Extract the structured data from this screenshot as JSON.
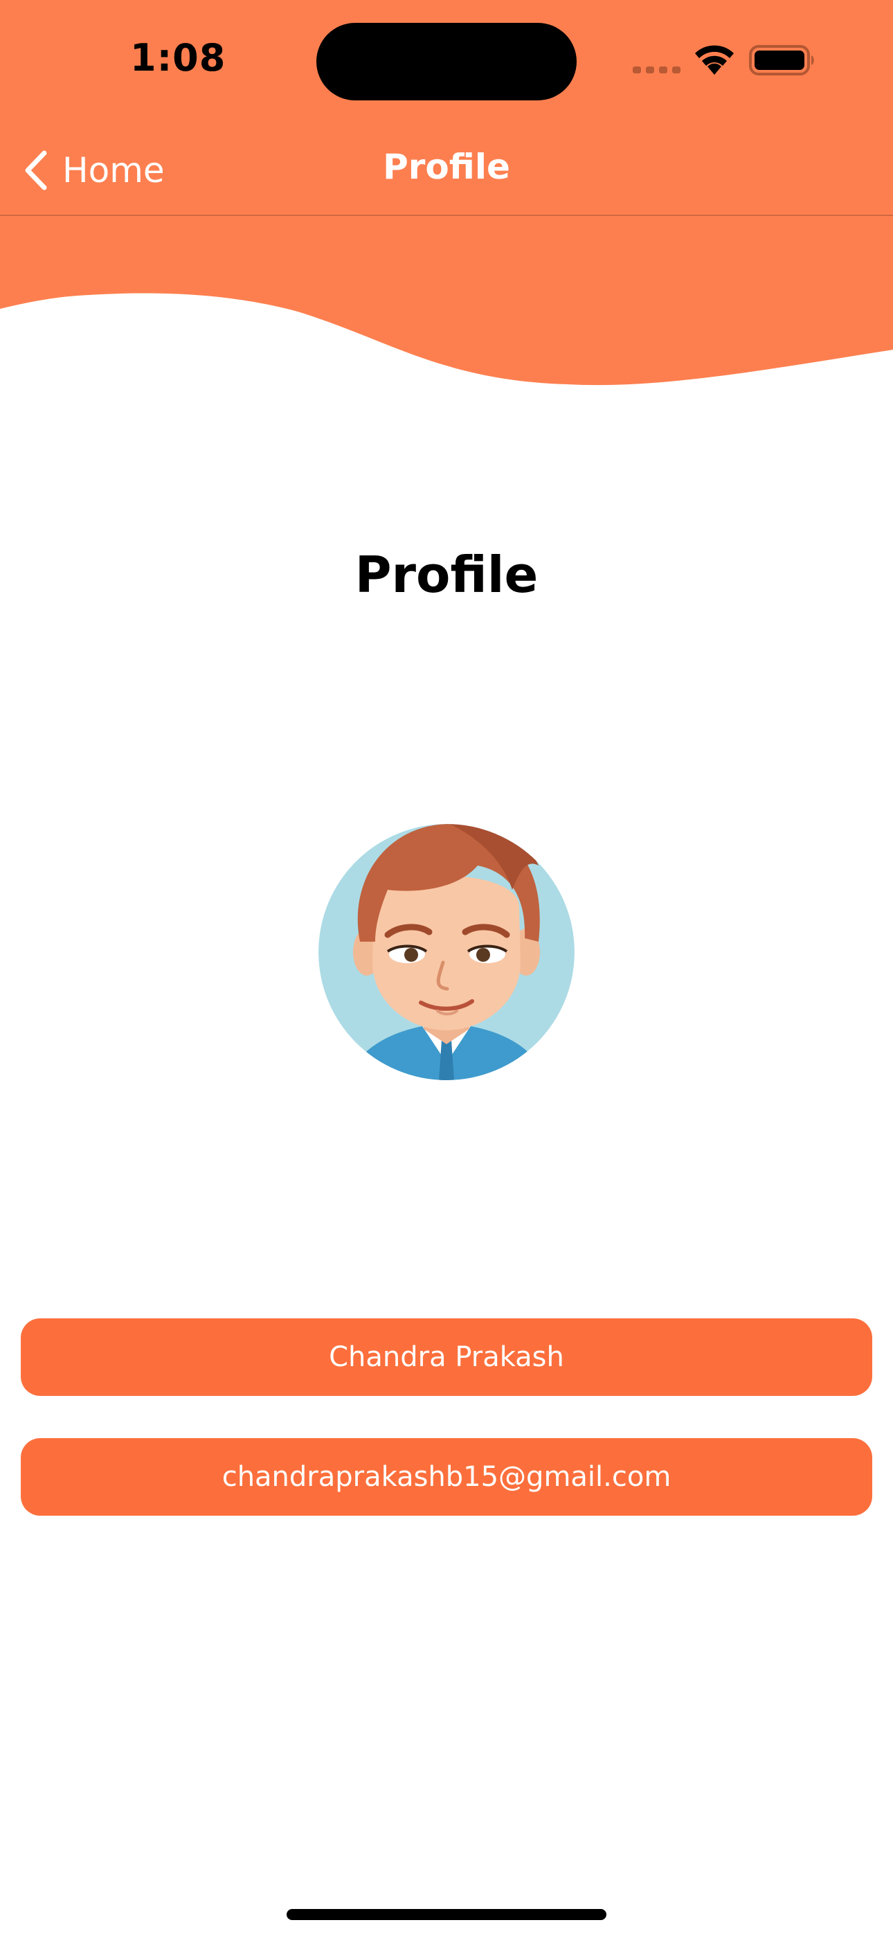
{
  "status_bar": {
    "time": "1:08"
  },
  "nav": {
    "back_label": "Home",
    "title": "Profile"
  },
  "content": {
    "title": "Profile",
    "name": "Chandra Prakash",
    "email": "chandraprakashb15@gmail.com"
  },
  "colors": {
    "header": "#fd7f4f",
    "pill": "#fc6f3c",
    "background": "#ffffff"
  },
  "icons": {
    "back": "chevron-left-icon",
    "wifi": "wifi-icon",
    "battery": "battery-icon",
    "avatar": "avatar-illustration"
  }
}
